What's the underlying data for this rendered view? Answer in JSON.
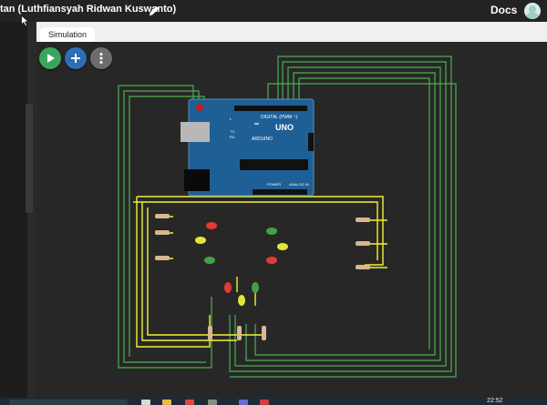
{
  "window": {
    "title": "tan (Luthfiansyah Ridwan Kuswanto)",
    "docs_label": "Docs"
  },
  "tabs": [
    {
      "label": "Simulation"
    }
  ],
  "toolbar": {
    "buttons": [
      {
        "name": "start-simulation-button",
        "icon": "play-icon",
        "color": "#3ba55c"
      },
      {
        "name": "add-component-button",
        "icon": "plus-icon",
        "color": "#2f6db5"
      },
      {
        "name": "more-options-button",
        "icon": "more-vertical-icon",
        "color": "#6d6d6d"
      }
    ]
  },
  "board": {
    "brand": "ARDUINO",
    "model": "UNO",
    "digital_label": "DIGITAL (PWM ~)",
    "power_label": "POWER",
    "analog_label": "ANALOG IN",
    "tx_label": "TX",
    "rx_label": "RX",
    "l_label": "L",
    "color": "#1e5f96"
  },
  "leds": {
    "colors": [
      "red",
      "yellow",
      "green"
    ]
  },
  "wire_colors": {
    "green": "#4caf50",
    "yellow": "#f2f230"
  },
  "taskbar": {
    "clock": "22:52"
  }
}
